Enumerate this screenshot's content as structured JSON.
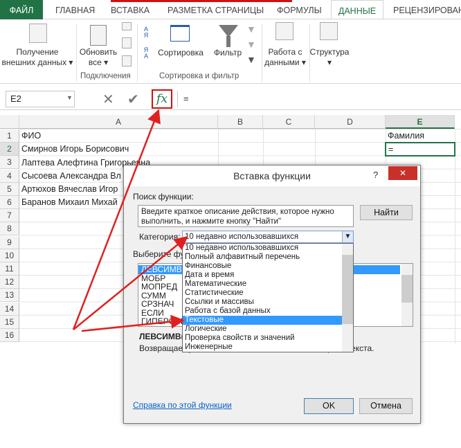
{
  "tabs": [
    "ФАЙЛ",
    "ГЛАВНАЯ",
    "ВСТАВКА",
    "РАЗМЕТКА СТРАНИЦЫ",
    "ФОРМУЛЫ",
    "ДАННЫЕ",
    "РЕЦЕНЗИРОВАНИЕ"
  ],
  "ribbon": {
    "get_external_1": "Получение",
    "get_external_2": "внешних данных ▾",
    "refresh_1": "Обновить",
    "refresh_2": "все ▾",
    "group_connections": "Подключения",
    "sort": "Сортировка",
    "filter": "Фильтр",
    "group_sort_filter": "Сортировка и фильтр",
    "data_tools_1": "Работа с",
    "data_tools_2": "данными ▾",
    "outline": "Структура",
    "outline_arrow": "▾",
    "az": "А Я",
    "za": "Я А"
  },
  "formula_bar": {
    "name_box": "E2",
    "cancel": "✕",
    "enter": "✔",
    "fx": "fx",
    "formula": "="
  },
  "columns": [
    "A",
    "B",
    "C",
    "D",
    "E"
  ],
  "rows": [
    "1",
    "2",
    "3",
    "4",
    "5",
    "6",
    "7",
    "8",
    "9",
    "10",
    "11",
    "12",
    "13",
    "14",
    "15",
    "16"
  ],
  "cells": {
    "A1": "ФИО",
    "A2": "Смирнов Игорь Борисович",
    "A3": "Лаптева Алефтина Григорьевна",
    "A4": "Сысоева Александра Вл",
    "A5": "Артюхов Вячеслав Игор",
    "A6": "Баранов Михаил Михай",
    "E1": "Фамилия",
    "E2": "="
  },
  "dialog": {
    "title": "Вставка функции",
    "help": "?",
    "close": "✕",
    "search_label": "Поиск функции:",
    "search_text": "Введите краткое описание действия, которое нужно выполнить, и нажмите кнопку \"Найти\"",
    "find": "Найти",
    "category_label": "Категория:",
    "category_value": "10 недавно использовавшихся",
    "choose_label": "Выберите функцию:",
    "functions": [
      "ЛЕВСИМВ",
      "МОБР",
      "МОПРЕД",
      "СУММ",
      "СРЗНАЧ",
      "ЕСЛИ",
      "ГИПЕРССЫЛКА"
    ],
    "signature": "ЛЕВСИМВ(текст;количество_знаков)",
    "description": "Возвращает указанное число знаков с начала строки текста.",
    "help_link": "Справка по этой функции",
    "ok": "OK",
    "cancel": "Отмена"
  },
  "category_options": [
    "10 недавно использовавшихся",
    "Полный алфавитный перечень",
    "Финансовые",
    "Дата и время",
    "Математические",
    "Статистические",
    "Ссылки и массивы",
    "Работа с базой данных",
    "Текстовые",
    "Логические",
    "Проверка свойств и значений",
    "Инженерные"
  ],
  "colors": {
    "excel_green": "#217346",
    "highlight": "#3399ff",
    "annotation": "#e02020"
  }
}
